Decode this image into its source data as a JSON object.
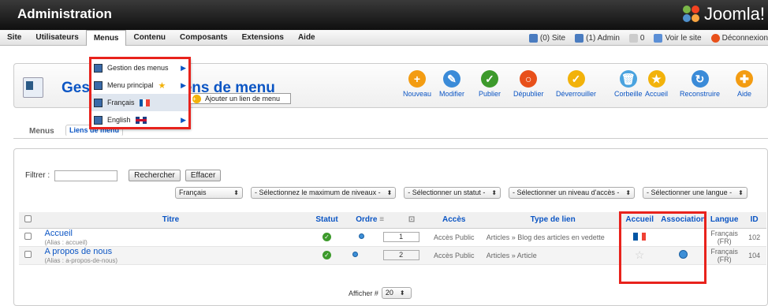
{
  "header": {
    "title": "Administration",
    "logo_text": "Joomla!"
  },
  "menubar": {
    "items": [
      "Site",
      "Utilisateurs",
      "Menus",
      "Contenu",
      "Composants",
      "Extensions",
      "Aide"
    ],
    "right": {
      "site": "(0) Site",
      "admin": "(1) Admin",
      "mail": "0",
      "view_site": "Voir le site",
      "logout": "Déconnexion"
    }
  },
  "dropdown": {
    "items": [
      {
        "label": "Gestion des menus",
        "arrow": "▶"
      },
      {
        "label": "Menu principal",
        "arrow": "▶"
      },
      {
        "label": "Français",
        "arrow": ""
      },
      {
        "label": "English",
        "arrow": "▶"
      }
    ]
  },
  "submenu": {
    "label": "Ajouter un lien de menu"
  },
  "page": {
    "title_prefix": "Gest",
    "title": ": Liens de menu"
  },
  "toolbar": [
    {
      "label": "Nouveau",
      "icon": "new-icon",
      "color": "#f39c12",
      "glyph": "+"
    },
    {
      "label": "Modifier",
      "icon": "edit-icon",
      "color": "#3b8bd8",
      "glyph": "✎"
    },
    {
      "label": "Publier",
      "icon": "publish-icon",
      "color": "#3d9a2c",
      "glyph": "✓"
    },
    {
      "label": "Dépublier",
      "icon": "unpublish-icon",
      "color": "#e8501a",
      "glyph": "○"
    },
    {
      "label": "Déverrouiller",
      "icon": "checkin-icon",
      "color": "#f2b20a",
      "glyph": "✓"
    },
    {
      "label": "Corbeille",
      "icon": "trash-icon",
      "color": "#4aa3df",
      "glyph": "🗑"
    },
    {
      "label": "Accueil",
      "icon": "home-star-icon",
      "color": "#f2b20a",
      "glyph": "★"
    },
    {
      "label": "Reconstruire",
      "icon": "rebuild-icon",
      "color": "#3b8bd8",
      "glyph": "↻"
    },
    {
      "label": "Aide",
      "icon": "help-icon",
      "color": "#f39c12",
      "glyph": "✚"
    }
  ],
  "tabs": [
    "Menus",
    "Liens de menu"
  ],
  "filter": {
    "label": "Filtrer :",
    "search_button": "Rechercher",
    "clear_button": "Effacer"
  },
  "selects": [
    "Français",
    "- Sélectionnez le maximum de niveaux -",
    "- Sélectionner un statut -",
    "- Sélectionner un niveau d'accès -",
    "- Sélectionner une langue -"
  ],
  "columns": [
    "Titre",
    "Statut",
    "Ordre",
    "Accès",
    "Type de lien",
    "Accueil",
    "Association",
    "Langue",
    "ID"
  ],
  "rows": [
    {
      "title": "Accueil",
      "alias": "(Alias : accueil)",
      "order": "1",
      "access": "Accès Public",
      "type": "Articles » Blog des articles en vedette",
      "language": "Français (FR)",
      "id": "102"
    },
    {
      "title": "A propos de nous",
      "alias": "(Alias : a-propos-de-nous)",
      "order": "2",
      "access": "Accès Public",
      "type": "Articles » Article",
      "language": "Français (FR)",
      "id": "104"
    }
  ],
  "pagination": {
    "label": "Afficher #",
    "value": "20"
  }
}
